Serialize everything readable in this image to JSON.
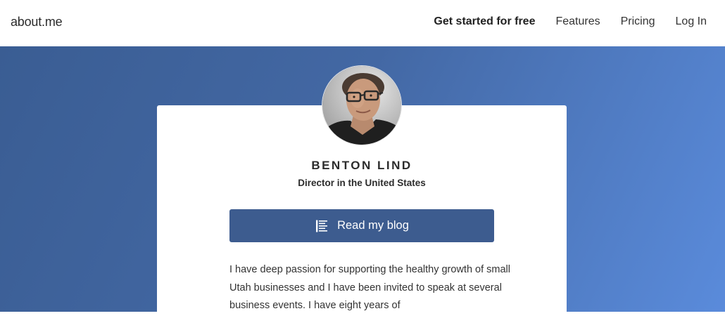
{
  "header": {
    "logo": "about.me",
    "nav": {
      "get_started": "Get started for free",
      "features": "Features",
      "pricing": "Pricing",
      "login": "Log In"
    }
  },
  "profile": {
    "name": "BENTON LIND",
    "subtitle": "Director in the United States",
    "blog_button_label": "Read my blog",
    "blog_button_icon": "document-lines-icon",
    "bio": "I have deep passion for supporting the healthy growth of small Utah businesses and I have been invited to speak at several business events. I have eight years of"
  },
  "colors": {
    "hero_gradient_start": "#3a5d93",
    "hero_gradient_end": "#5a8bdb",
    "button": "#3d5c8f",
    "card": "#ffffff"
  }
}
